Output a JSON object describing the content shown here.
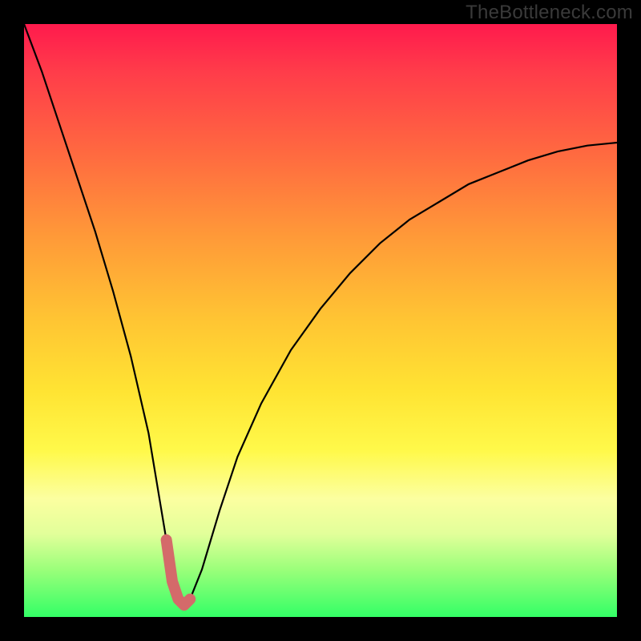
{
  "watermark": "TheBottleneck.com",
  "colors": {
    "background": "#000000",
    "gradient_top": "#ff1a4d",
    "gradient_bottom": "#33ff66",
    "curve_stroke": "#000000",
    "trough_stroke": "#d46a6a"
  },
  "chart_data": {
    "type": "line",
    "title": "",
    "xlabel": "",
    "ylabel": "",
    "xlim": [
      0,
      100
    ],
    "ylim": [
      0,
      100
    ],
    "series": [
      {
        "name": "bottleneck-curve",
        "x": [
          0,
          3,
          6,
          9,
          12,
          15,
          18,
          21,
          24,
          25,
          26,
          27,
          28,
          30,
          33,
          36,
          40,
          45,
          50,
          55,
          60,
          65,
          70,
          75,
          80,
          85,
          90,
          95,
          100
        ],
        "y": [
          100,
          92,
          83,
          74,
          65,
          55,
          44,
          31,
          13,
          6,
          3,
          2,
          3,
          8,
          18,
          27,
          36,
          45,
          52,
          58,
          63,
          67,
          70,
          73,
          75,
          77,
          78.5,
          79.5,
          80
        ]
      }
    ],
    "annotations": [
      {
        "name": "trough-highlight",
        "x_range": [
          23.5,
          29.5
        ],
        "y_range": [
          2,
          14
        ],
        "color": "#d46a6a"
      }
    ]
  }
}
